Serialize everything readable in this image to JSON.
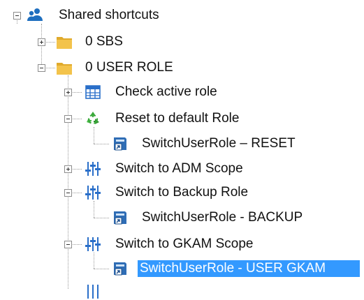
{
  "tree": {
    "root": {
      "label": "Shared shortcuts",
      "icon": "users-icon",
      "expanded": true
    },
    "sbs": {
      "label": "0 SBS",
      "icon": "folder-icon",
      "expanded": false
    },
    "user_role": {
      "label": "0 USER ROLE",
      "icon": "folder-icon",
      "expanded": true
    },
    "items": [
      {
        "label": "Check active role",
        "icon": "table-icon",
        "expanded": false
      },
      {
        "label": "Reset to default Role",
        "icon": "recycle-icon",
        "expanded": true
      },
      {
        "label": "SwitchUserRole – RESET",
        "icon": "shortcut-icon"
      },
      {
        "label": "Switch to ADM Scope",
        "icon": "sliders-icon",
        "expanded": false
      },
      {
        "label": "Switch to Backup Role",
        "icon": "sliders-icon",
        "expanded": true
      },
      {
        "label": "SwitchUserRole - BACKUP",
        "icon": "shortcut-icon"
      },
      {
        "label": "Switch to GKAM Scope",
        "icon": "sliders-icon",
        "expanded": true
      },
      {
        "label": "SwitchUserRole - USER GKAM",
        "icon": "shortcut-icon",
        "selected": true
      }
    ]
  },
  "colors": {
    "selection": "#3399ff",
    "folder": "#f3c34b",
    "group": "#1f6fbf",
    "recycle": "#3aa93a"
  }
}
